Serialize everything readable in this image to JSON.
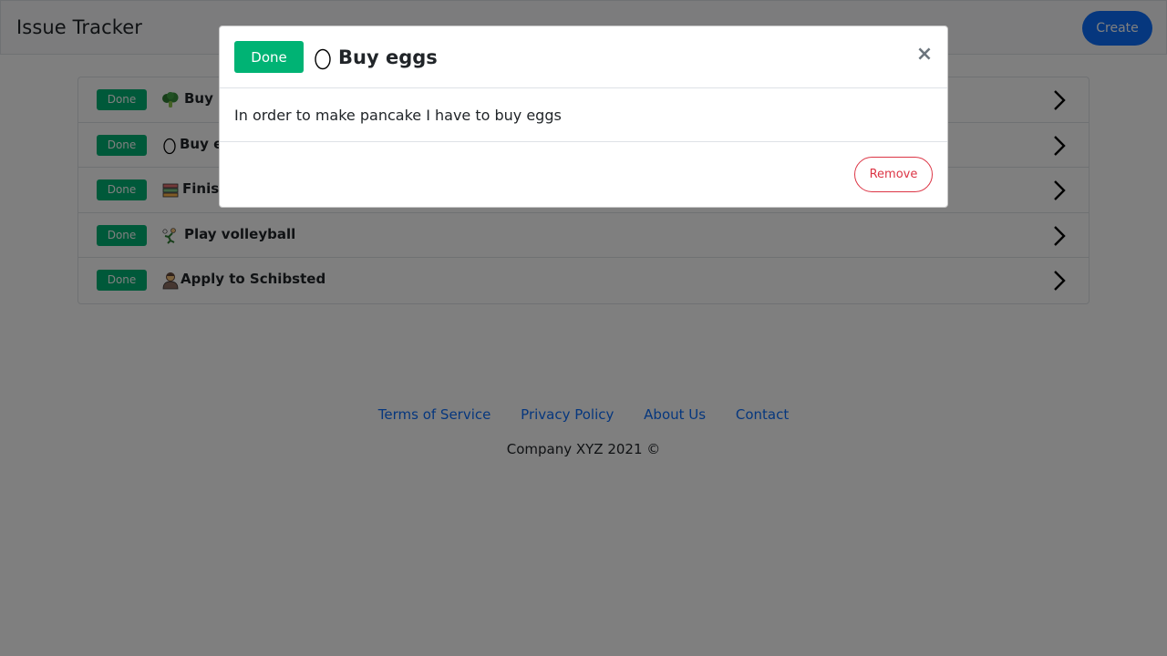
{
  "navbar": {
    "brand": "Issue Tracker",
    "create_label": "Create"
  },
  "issues": [
    {
      "status": "Done",
      "title": "Buy b",
      "icon": "broccoli-icon"
    },
    {
      "status": "Done",
      "title": "Buy eg",
      "icon": "egg-icon"
    },
    {
      "status": "Done",
      "title": "Finish",
      "icon": "books-icon"
    },
    {
      "status": "Done",
      "title": "Play volleyball",
      "icon": "volleyball-player-icon"
    },
    {
      "status": "Done",
      "title": "Apply to Schibsted",
      "icon": "person-icon"
    }
  ],
  "footer": {
    "links": [
      "Terms of Service",
      "Privacy Policy",
      "About Us",
      "Contact"
    ],
    "copyright": "Company XYZ 2021 ©"
  },
  "modal": {
    "status": "Done",
    "icon": "egg-icon",
    "title": "Buy eggs",
    "close_label": "×",
    "description": "In order to make pancake I have to buy eggs",
    "remove_label": "Remove"
  },
  "colors": {
    "done_green": "#00b374",
    "primary_blue": "#0d6efd",
    "danger_red": "#dc3545"
  }
}
